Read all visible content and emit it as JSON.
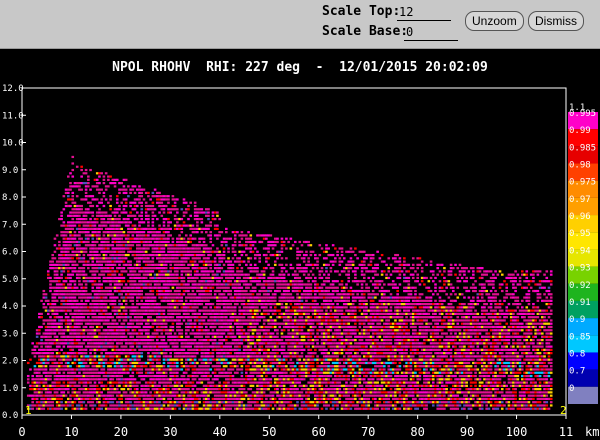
{
  "toolbar": {
    "scale_top_label": "Scale Top:",
    "scale_top_value": "12",
    "scale_base_label": "Scale Base:",
    "scale_base_value": "0",
    "unzoom_label": "Unzoom",
    "dismiss_label": "Dismiss"
  },
  "chart_data": {
    "type": "heatmap",
    "title": "NPOL RHOHV  RHI: 227 deg  -  12/01/2015 20:02:09",
    "x_ticks": [
      "0",
      "10",
      "20",
      "30",
      "40",
      "50",
      "60",
      "70",
      "80",
      "90",
      "100",
      "11"
    ],
    "x_unit": "km",
    "xlim": [
      0,
      110
    ],
    "y_ticks": [
      "0.0",
      "1.0",
      "2.0",
      "3.0",
      "4.0",
      "5.0",
      "6.0",
      "7.0",
      "8.0",
      "9.0",
      "10.0",
      "11.0",
      "12.0"
    ],
    "ylim": [
      0,
      12
    ],
    "corner_labels": [
      "1",
      "2"
    ],
    "colorbar": {
      "levels": [
        "1.1",
        "0.995",
        "0.99",
        "0.985",
        "0.98",
        "0.975",
        "0.97",
        "0.96",
        "0.95",
        "0.94",
        "0.93",
        "0.92",
        "0.91",
        "0.9",
        "0.85",
        "0.8",
        "0.7",
        "0"
      ],
      "colors": [
        "#d0109a",
        "#ff00c8",
        "#ff0000",
        "#e60000",
        "#ff4000",
        "#ff8c00",
        "#ff9f00",
        "#ffd000",
        "#ffe600",
        "#e6e600",
        "#78d200",
        "#1eb41e",
        "#00a060",
        "#00aaff",
        "#00c8ff",
        "#0000ff",
        "#0000b0",
        "#8080c0"
      ]
    },
    "image_description_colors": {
      "background": "#000000",
      "dominant": "#e0108f",
      "secondary": [
        "#ff0000",
        "#ffd000",
        "#00c8ff",
        "#5050c0"
      ]
    }
  }
}
